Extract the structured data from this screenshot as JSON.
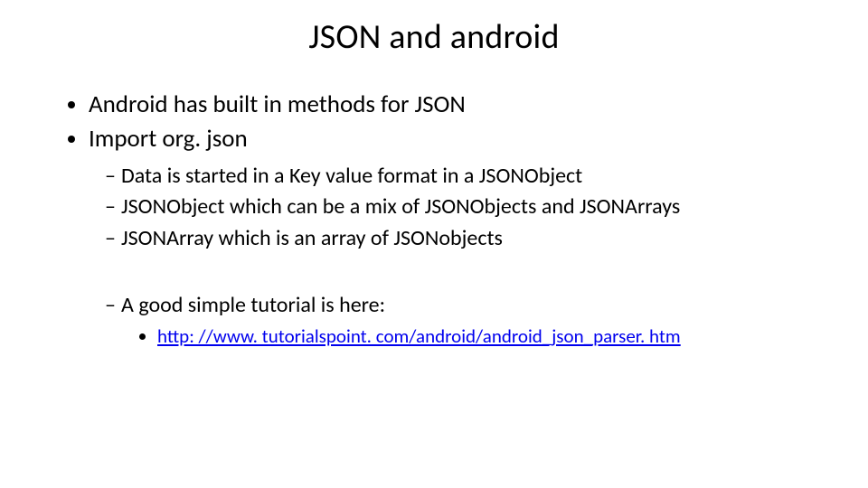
{
  "slide": {
    "title": "JSON and android",
    "bullets": {
      "b1": "Android has built in methods for JSON",
      "b2": "Import org. json",
      "sub": {
        "s1": "Data is started in a Key value format in a JSONObject",
        "s2": "JSONObject  which can be a mix of JSONObjects and JSONArrays",
        "s3": "JSONArray which is an array of JSONobjects",
        "s4": "A good simple tutorial is here:",
        "link": "http: //www. tutorialspoint. com/android/android_json_parser. htm"
      }
    }
  }
}
